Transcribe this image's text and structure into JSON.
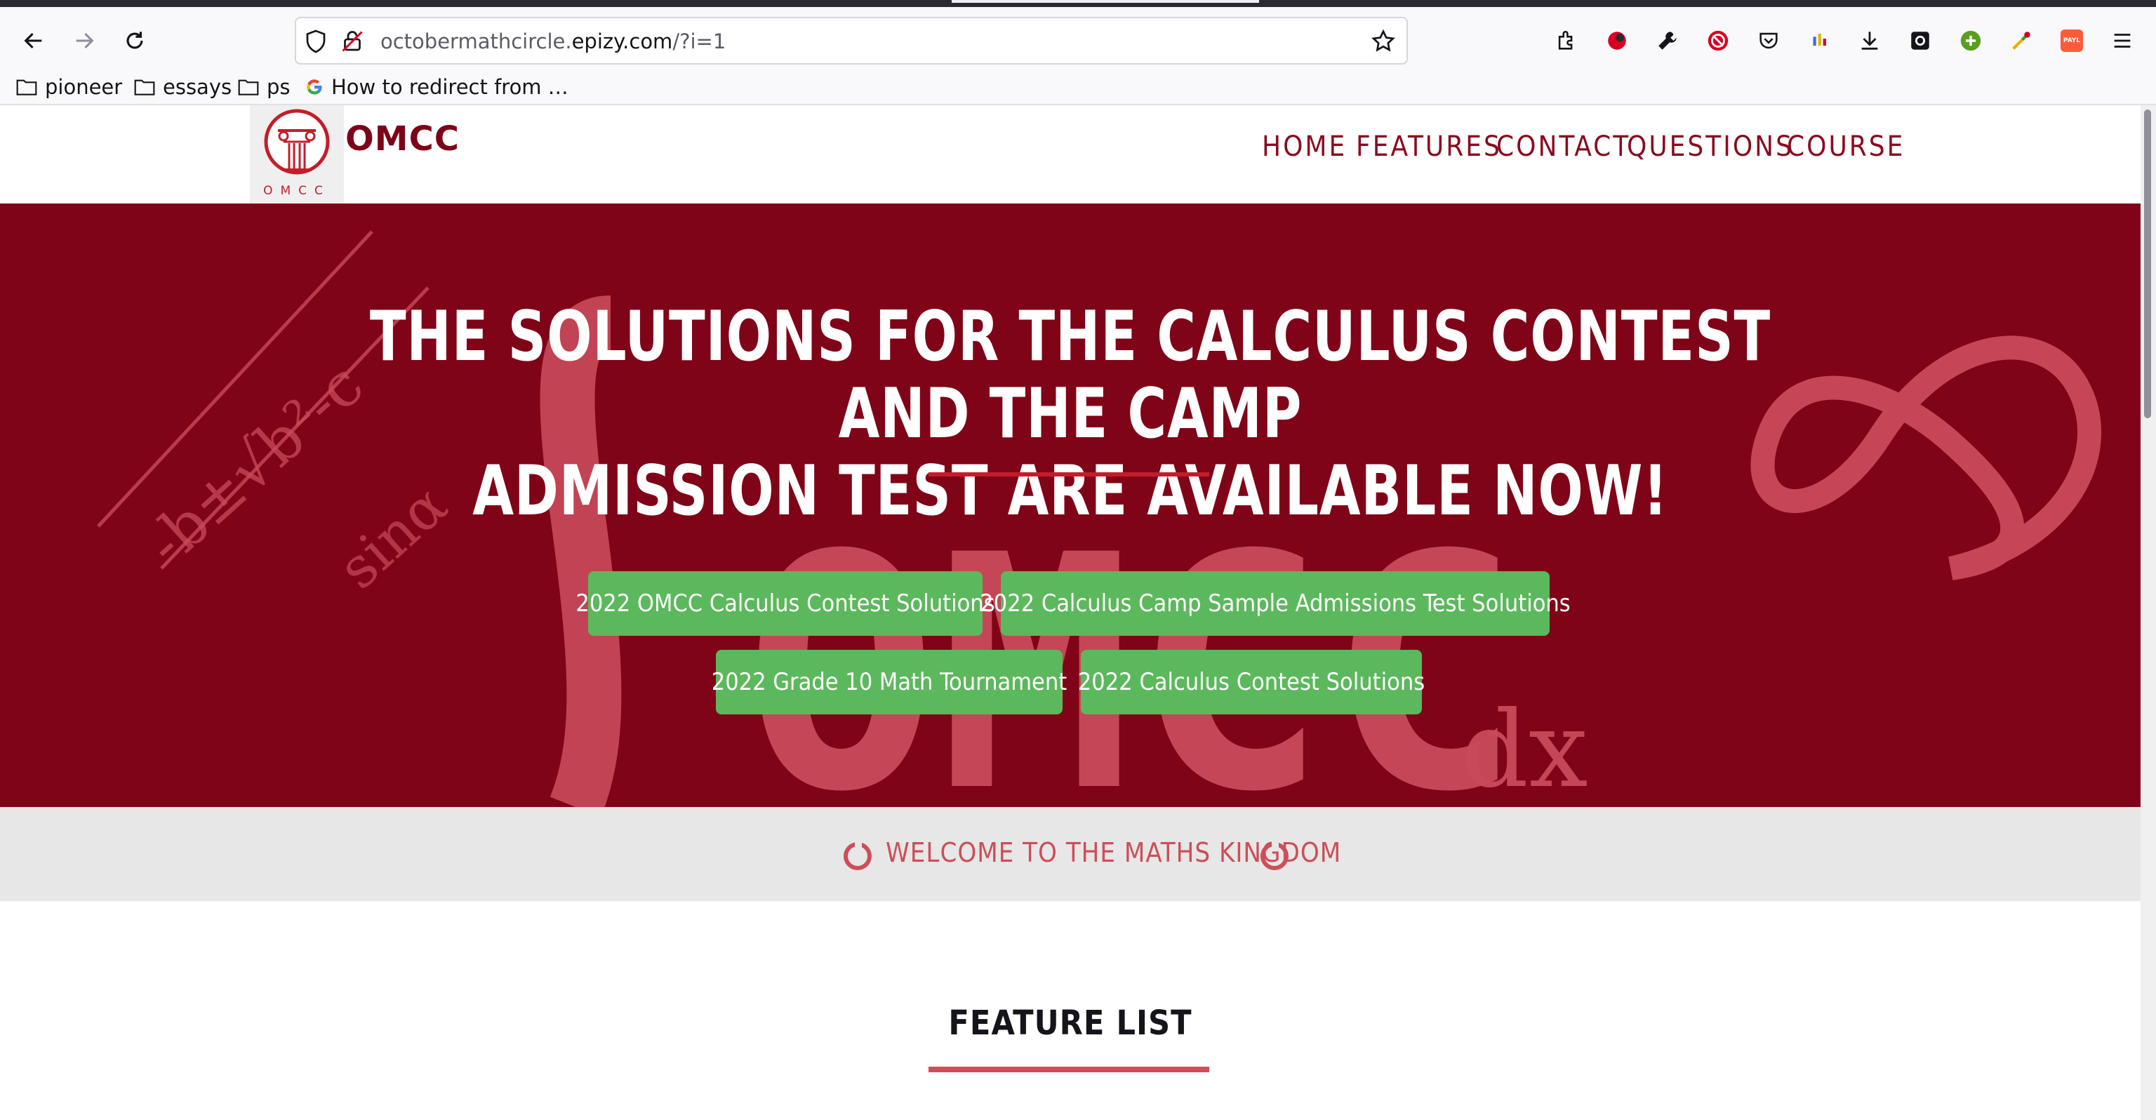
{
  "browser": {
    "url_prefix": "octobermathcircle.",
    "url_domain": "epizy.com",
    "url_path": "/?i=1",
    "bookmarks": [
      {
        "label": "pioneer",
        "icon": "folder-icon"
      },
      {
        "label": "essays",
        "icon": "folder-icon"
      },
      {
        "label": "ps",
        "icon": "folder-icon"
      },
      {
        "label": "How to redirect from …",
        "icon": "google-icon"
      }
    ],
    "extension_badge": "PAYL"
  },
  "site": {
    "logo_caption": "OMCC",
    "brand": "OMCC",
    "menu": [
      "HOME",
      "FEATURES",
      "CONTACT",
      "QUESTIONS",
      "COURSE"
    ],
    "hero": {
      "title_line1": "THE SOLUTIONS FOR THE CALCULUS CONTEST AND THE CAMP",
      "title_line2": "ADMISSION TEST ARE AVAILABLE NOW!",
      "background_word": "OMCC",
      "background_dx": "dx",
      "background_formula": "-b±√b²-c",
      "background_formula2": "sinα",
      "buttons": [
        "2022 OMCC Calculus Contest Solutions",
        "2022 Calculus Camp Sample Admissions Test Solutions",
        "2022 Grade 10 Math Tournament",
        "2022 Calculus Contest Solutions"
      ]
    },
    "welcome": "WELCOME TO THE MATHS KINGDOM",
    "feature_title": "FEATURE LIST"
  },
  "colors": {
    "brand_red": "#800417",
    "button_green": "#5cb85c",
    "accent_pink": "#cd4e58"
  }
}
